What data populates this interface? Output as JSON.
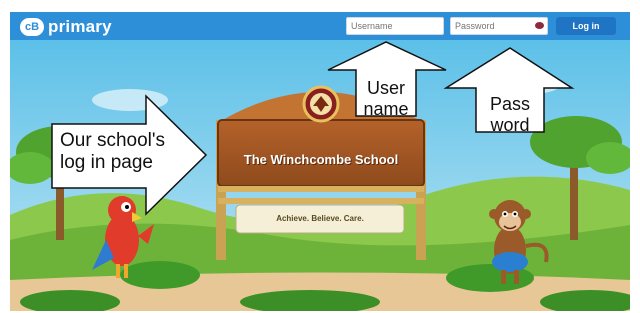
{
  "header": {
    "logo_mark": "cB",
    "logo_text": "primary",
    "username_placeholder": "Username",
    "password_placeholder": "Password",
    "login_label": "Log in",
    "brand_color": "#2e8fd9"
  },
  "sign": {
    "school_name": "The Winchcombe School",
    "motto": "Achieve. Believe. Care.",
    "crest_text": "Winchcombe"
  },
  "annotations": {
    "school_page": [
      "Our school's",
      "log in page"
    ],
    "user_name": [
      "User",
      "name"
    ],
    "password": [
      "Pass",
      "word"
    ]
  },
  "icons": {
    "password_reveal": "eye-icon",
    "crest": "crest-icon"
  }
}
